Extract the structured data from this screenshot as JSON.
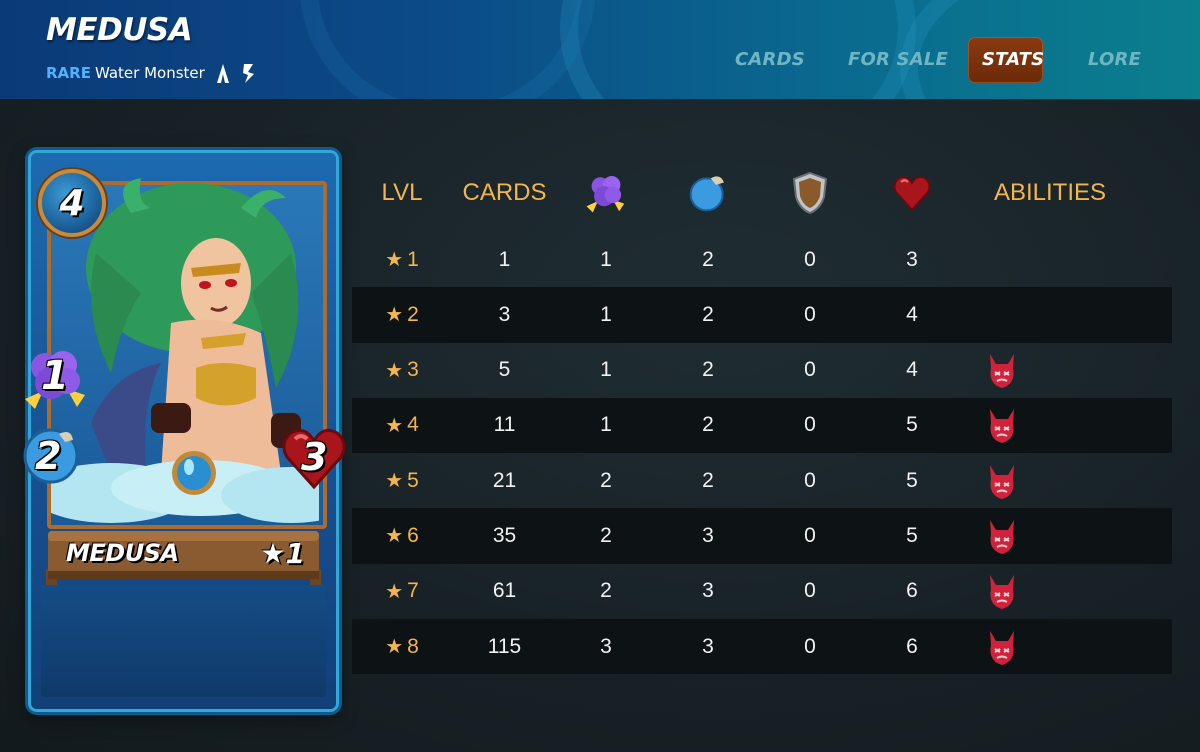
{
  "header": {
    "title": "MEDUSA",
    "rarity": "RARE",
    "type_text": "Water Monster",
    "edition_icons": [
      "alpha-edition-icon",
      "beta-edition-icon"
    ],
    "tabs": [
      {
        "label": "CARDS",
        "active": false
      },
      {
        "label": "FOR SALE",
        "active": false
      },
      {
        "label": "STATS",
        "active": true
      },
      {
        "label": "LORE",
        "active": false
      }
    ]
  },
  "card": {
    "name": "MEDUSA",
    "mana": "4",
    "attack": "1",
    "speed": "2",
    "health": "3",
    "level_label": "★1",
    "element": "water",
    "accent_color": "#32a7d8"
  },
  "stats_table": {
    "headers": {
      "level": "LVL",
      "cards": "CARDS",
      "attack_icon": "magic-attack-icon",
      "speed_icon": "speed-icon",
      "armor_icon": "armor-shield-icon",
      "health_icon": "health-heart-icon",
      "abilities": "ABILITIES"
    },
    "rows": [
      {
        "level": "1",
        "cards": "1",
        "attack": "1",
        "speed": "2",
        "armor": "0",
        "health": "3",
        "ability": ""
      },
      {
        "level": "2",
        "cards": "3",
        "attack": "1",
        "speed": "2",
        "armor": "0",
        "health": "4",
        "ability": ""
      },
      {
        "level": "3",
        "cards": "5",
        "attack": "1",
        "speed": "2",
        "armor": "0",
        "health": "4",
        "ability": "demon-ability-icon"
      },
      {
        "level": "4",
        "cards": "11",
        "attack": "1",
        "speed": "2",
        "armor": "0",
        "health": "5",
        "ability": "demon-ability-icon"
      },
      {
        "level": "5",
        "cards": "21",
        "attack": "2",
        "speed": "2",
        "armor": "0",
        "health": "5",
        "ability": "demon-ability-icon"
      },
      {
        "level": "6",
        "cards": "35",
        "attack": "2",
        "speed": "3",
        "armor": "0",
        "health": "5",
        "ability": "demon-ability-icon"
      },
      {
        "level": "7",
        "cards": "61",
        "attack": "2",
        "speed": "3",
        "armor": "0",
        "health": "6",
        "ability": "demon-ability-icon"
      },
      {
        "level": "8",
        "cards": "115",
        "attack": "3",
        "speed": "3",
        "armor": "0",
        "health": "6",
        "ability": "demon-ability-icon"
      }
    ]
  }
}
